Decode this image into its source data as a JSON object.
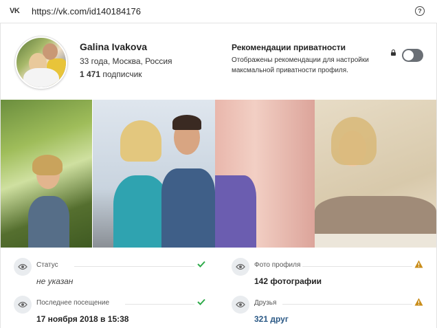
{
  "browser": {
    "logo": "VK",
    "url": "https://vk.com/id140184176",
    "help_symbol": "?"
  },
  "profile": {
    "name": "Galina Ivakova",
    "info": "33 года, Москва, Россия",
    "followers_count": "1 471",
    "followers_label": "подписчик"
  },
  "privacy": {
    "title": "Рекомендации приватности",
    "description": "Отображены рекомендации для настройки максмальной приватности профиля.",
    "toggle_on": false
  },
  "gallery": {
    "photo_count": 4
  },
  "fields": [
    {
      "label": "Статус",
      "value": "не указан",
      "status": "ok",
      "value_style": "italic"
    },
    {
      "label": "Фото профиля",
      "value": "142 фотографии",
      "status": "warning",
      "value_style": "bold"
    },
    {
      "label": "Последнее посещение",
      "value": "17 ноября 2018 в 15:38",
      "status": "ok",
      "value_style": "bold"
    },
    {
      "label": "Друзья",
      "value": "321 друг",
      "status": "warning",
      "value_style": "link"
    }
  ],
  "colors": {
    "ok": "#2eaa4a",
    "warning": "#c98d1a",
    "link": "#2a5885",
    "toggle_off": "#6a6f75"
  }
}
